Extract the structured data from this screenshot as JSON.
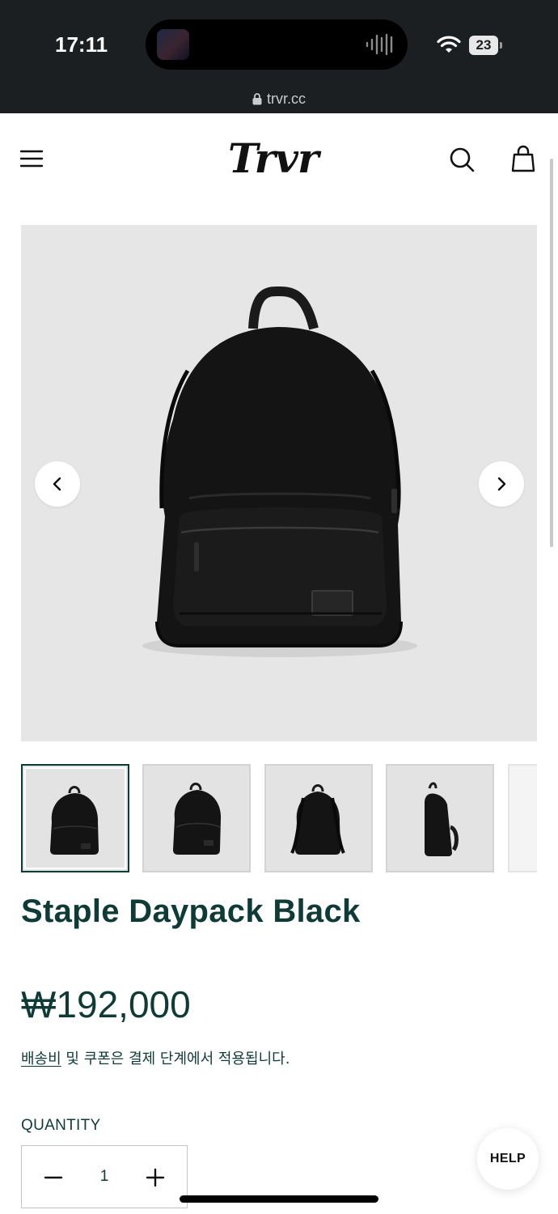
{
  "status_bar": {
    "time": "17:11",
    "battery": "23",
    "url": "trvr.cc"
  },
  "header": {
    "logo": "Trvr",
    "icons": [
      "menu-icon",
      "search-icon",
      "bag-icon"
    ]
  },
  "gallery": {
    "thumbnail_count_visible": 5,
    "active_index": 0
  },
  "product": {
    "title": "Staple Daypack Black",
    "price": "₩192,000",
    "shipping_link": "배송비",
    "shipping_text": " 및 쿠폰은 결제 단계에서 적용됩니다."
  },
  "quantity": {
    "label": "QUANTITY",
    "value": "1"
  },
  "help": {
    "label": "HELP"
  },
  "colors": {
    "brand": "#0f3b36",
    "status_bar": "#1c1f22",
    "image_bg": "#e6e6e6"
  }
}
